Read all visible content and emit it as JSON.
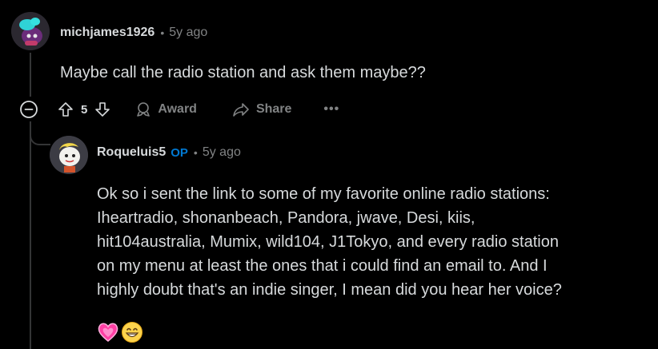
{
  "colors": {
    "background": "#000000",
    "text": "#d7dadc",
    "meta": "#818384",
    "op_badge": "#0079d3",
    "thread_line": "#343536"
  },
  "comment": {
    "author": "michjames1926",
    "separator": "•",
    "time": "5y ago",
    "body": "Maybe call the radio station and ask them maybe??",
    "avatar_icon": "snoo-avatar-icon",
    "actions": {
      "collapse_icon": "collapse-minus-icon",
      "upvote_icon": "upvote-arrow-icon",
      "score": "5",
      "downvote_icon": "downvote-arrow-icon",
      "award_label": "Award",
      "award_icon": "award-icon",
      "share_label": "Share",
      "share_icon": "share-arrow-icon",
      "more_label": "•••"
    }
  },
  "reply": {
    "author": "Roqueluis5",
    "op_badge": "OP",
    "separator": "•",
    "time": "5y ago",
    "avatar_icon": "snoo-avatar-icon",
    "body_lines": [
      "Ok so i sent the link to some of my favorite online radio stations:",
      "Iheartradio, shonanbeach, Pandora, jwave, Desi, kiis,",
      "hit104australia, Mumix, wild104, J1Tokyo, and every radio station",
      "on my menu at least the ones that i could find an email to. And I",
      "highly doubt that's an indie singer, I mean did you hear her voice?"
    ],
    "emojis": [
      "💓",
      "😁"
    ]
  }
}
